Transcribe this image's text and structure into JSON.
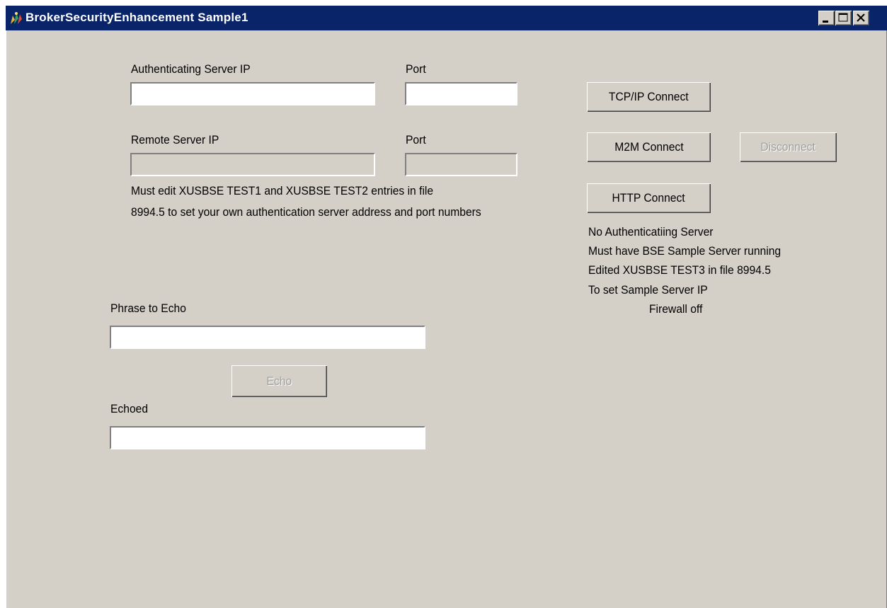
{
  "window": {
    "title": "BrokerSecurityEnhancement Sample1",
    "controls": [
      "minimize",
      "maximize",
      "close"
    ]
  },
  "auth": {
    "ip_label": "Authenticating Server IP",
    "ip_value": "",
    "port_label": "Port",
    "port_value": ""
  },
  "remote": {
    "ip_label": "Remote Server IP",
    "ip_value": "",
    "port_label": "Port",
    "port_value": ""
  },
  "note": {
    "line1": "Must edit XUSBSE TEST1 and XUSBSE TEST2 entries in file",
    "line2": "8994.5 to set your own authentication server address and port numbers"
  },
  "buttons": {
    "tcpip": "TCP/IP Connect",
    "m2m": "M2M Connect",
    "disconnect": "Disconnect",
    "http": "HTTP Connect",
    "echo": "Echo"
  },
  "info": {
    "line1": "No Authenticatiing Server",
    "line2": "Must have BSE Sample Server running",
    "line3": "Edited XUSBSE TEST3 in file 8994.5",
    "line4": "To set Sample Server IP",
    "line5": "Firewall off"
  },
  "echo": {
    "phrase_label": "Phrase to Echo",
    "phrase_value": "",
    "echoed_label": "Echoed",
    "echoed_value": ""
  },
  "colors": {
    "titlebar": "#0a246a",
    "face": "#d4d0c8"
  }
}
